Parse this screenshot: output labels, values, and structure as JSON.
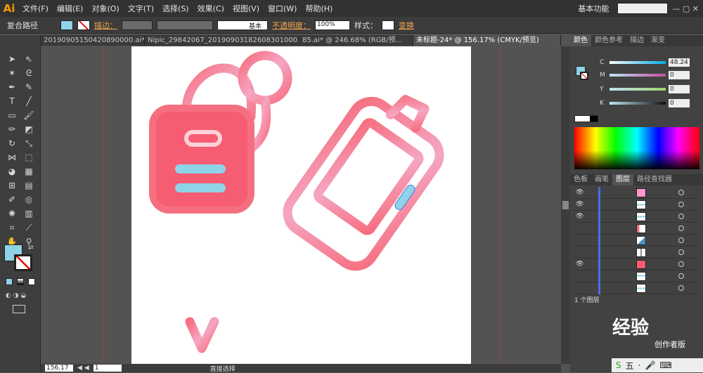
{
  "app": {
    "logo": "Ai"
  },
  "menu": [
    "文件(F)",
    "编辑(E)",
    "对象(O)",
    "文字(T)",
    "选择(S)",
    "效果(C)",
    "视图(V)",
    "窗口(W)",
    "帮助(H)"
  ],
  "workspace": {
    "label": "基本功能",
    "search_icon": "search-icon"
  },
  "control": {
    "object_type": "复合路径",
    "fill_color": "#8fd3e8",
    "stroke_label": "描边：",
    "stroke_style": "基本",
    "opacity_label": "不透明度：",
    "opacity_value": "100%",
    "style_label": "样式：",
    "transform_label": "变换"
  },
  "tabs": [
    "20190905150420890000.ai*",
    "Nipic_29842067_20190903182608301000.ai*",
    "85.ai* @ 246.68% (RGB/预...",
    "未标题-24* @ 156.17% (CMYK/预览)"
  ],
  "status": {
    "zoom": "156.17",
    "artboard": "1",
    "tool": "直接选择"
  },
  "panels": {
    "color_tabs": [
      "颜色",
      "颜色参考",
      "描边",
      "渐变"
    ],
    "cmyk": [
      {
        "ch": "C",
        "value": "48.24"
      },
      {
        "ch": "M",
        "value": "0"
      },
      {
        "ch": "Y",
        "value": "0"
      },
      {
        "ch": "K",
        "value": "0"
      }
    ],
    "lower_tabs": [
      "色板",
      "画笔",
      "图层",
      "路径查找器"
    ],
    "layers_count": "1 个图层",
    "watermark": "经验",
    "watermark_sub": "创作者版"
  },
  "colors": {
    "accent": "#f66f80",
    "fill": "#8fd3e8",
    "guide": "#c0392b"
  }
}
